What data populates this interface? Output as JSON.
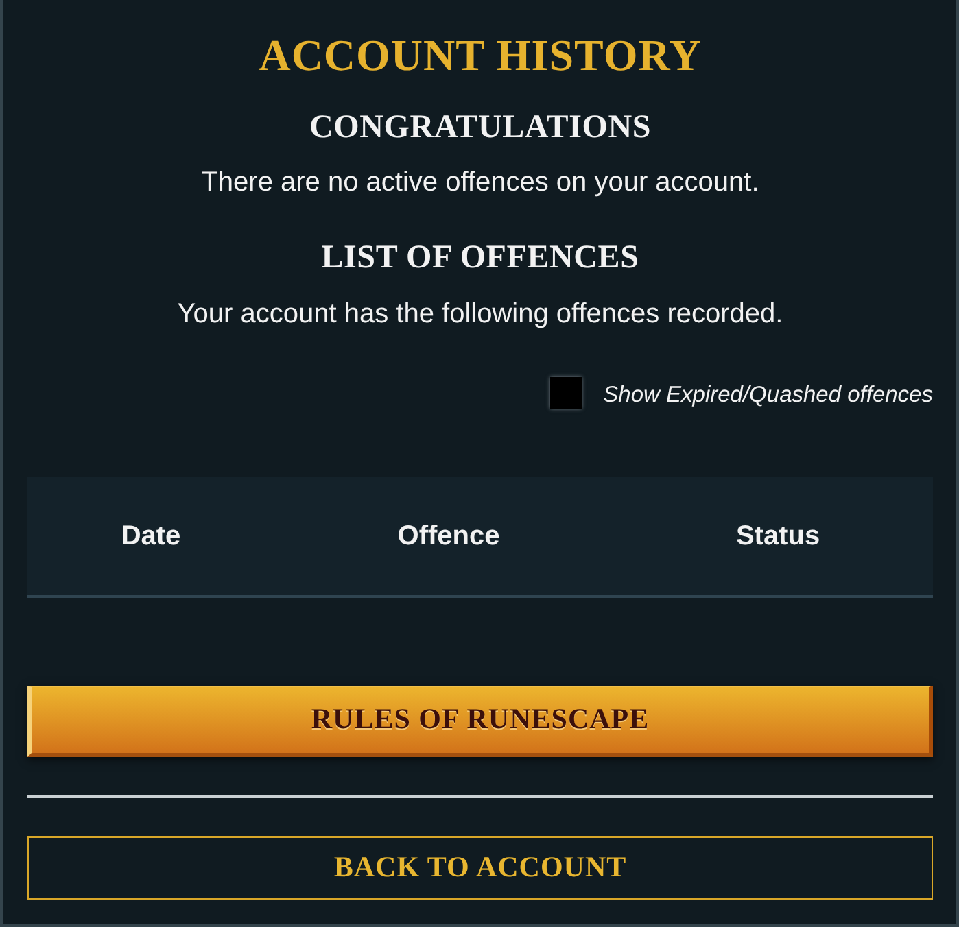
{
  "page": {
    "title": "ACCOUNT HISTORY"
  },
  "sections": [
    {
      "heading": "CONGRATULATIONS",
      "text": "There are no active offences on your account."
    },
    {
      "heading": "LIST OF OFFENCES",
      "text": "Your account has the following offences recorded."
    }
  ],
  "filter": {
    "label": "Show Expired/Quashed offences",
    "checked": false
  },
  "table": {
    "columns": [
      "Date",
      "Offence",
      "Status"
    ]
  },
  "buttons": [
    {
      "label": "RULES OF RUNESCAPE",
      "kind": "primary"
    },
    {
      "label": "BACK TO ACCOUNT",
      "kind": "outline"
    }
  ]
}
